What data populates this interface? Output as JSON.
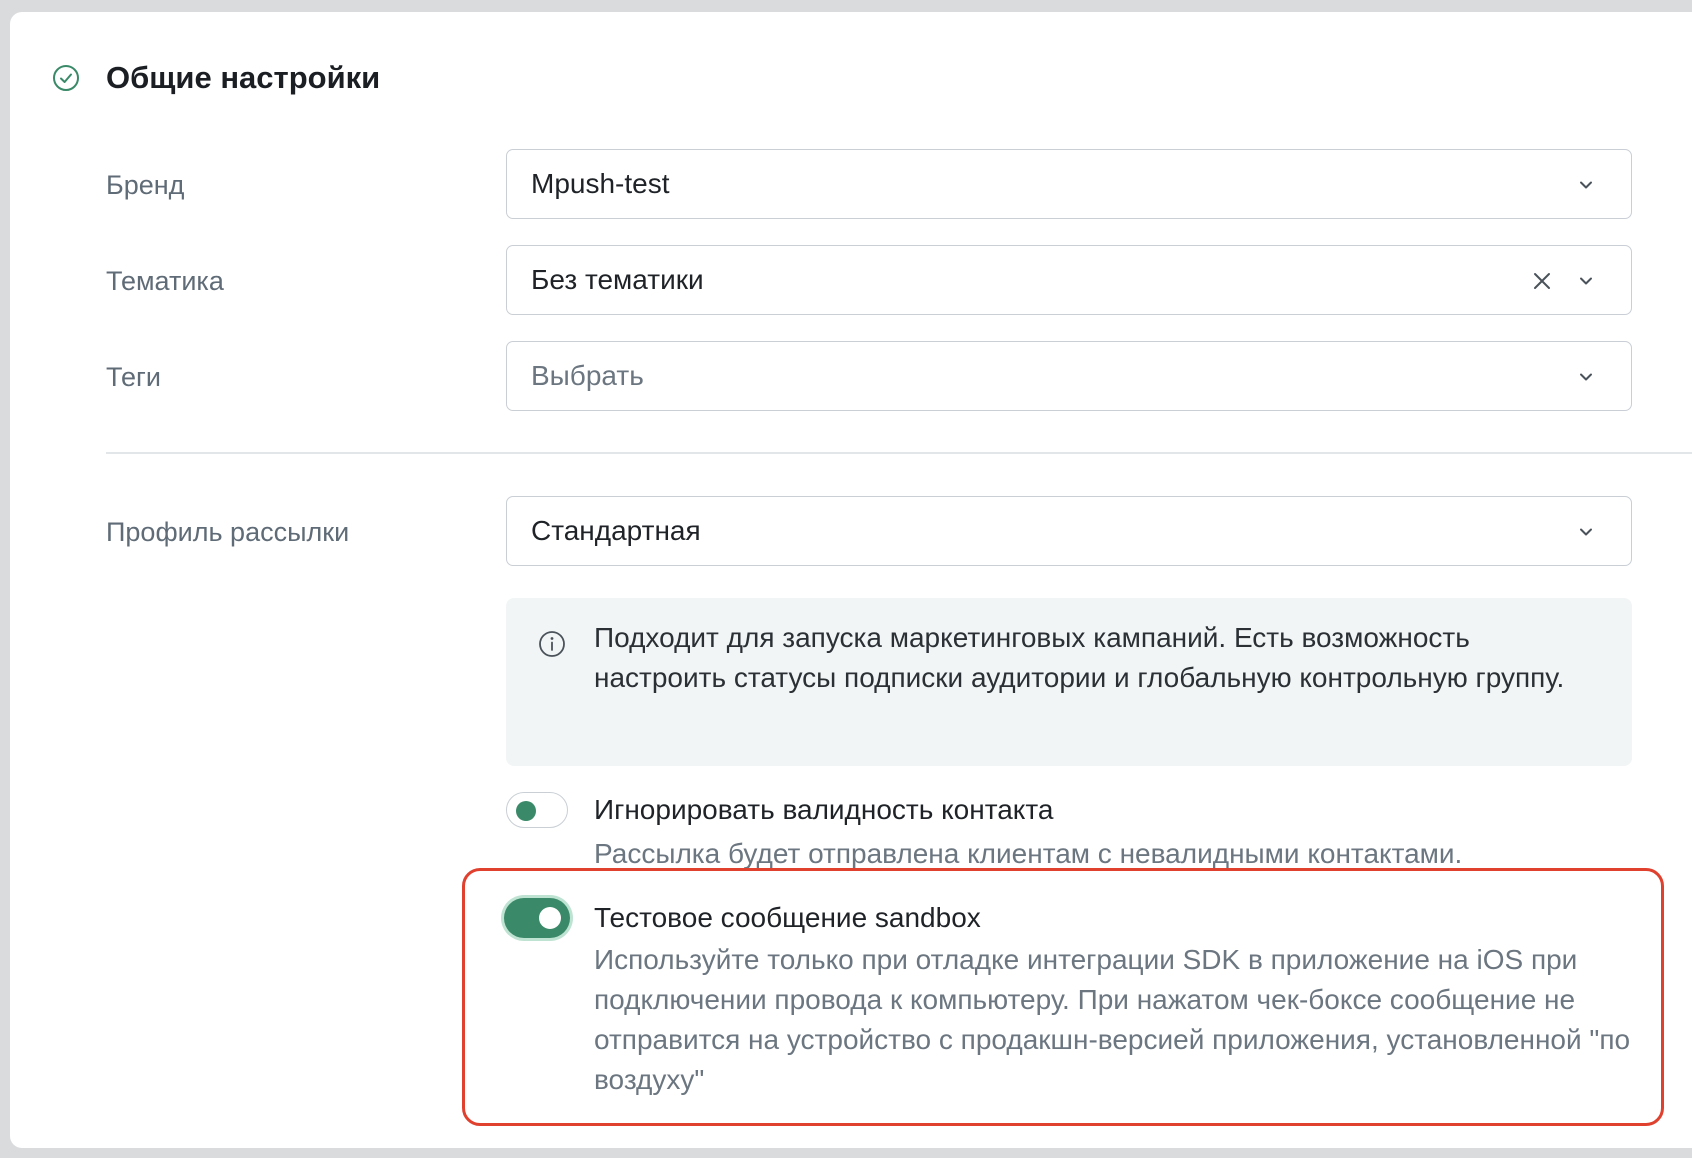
{
  "section": {
    "title": "Общие настройки",
    "icon": "check-circle-icon",
    "icon_color": "#3a8a69"
  },
  "fields": {
    "brand": {
      "label": "Бренд",
      "value": "Mpush-test"
    },
    "topic": {
      "label": "Тематика",
      "value": "Без тематики"
    },
    "tags": {
      "label": "Теги",
      "placeholder": "Выбрать"
    },
    "profile": {
      "label": "Профиль рассылки",
      "value": "Стандартная"
    }
  },
  "profile_info": {
    "icon": "info-icon",
    "text": "Подходит для запуска маркетинговых кампаний. Есть возможность настроить статусы подписки аудитории и глобальную контрольную группу."
  },
  "options": {
    "ignore_validity": {
      "title": "Игнорировать валидность контакта",
      "description": "Рассылка будет отправлена клиентам с невалидными контактами.",
      "enabled": false
    },
    "sandbox": {
      "title": "Тестовое сообщение sandbox",
      "description": "Используйте только при отладке интеграции SDK в приложение на iOS при подключении провода к компьютеру. При нажатом чек-боксе сообщение не отправится на устройство с продакшн-версией приложения, установленной \"по воздуху\"",
      "enabled": true
    }
  },
  "colors": {
    "accent": "#3a8a69",
    "highlight_border": "#e0412f"
  }
}
